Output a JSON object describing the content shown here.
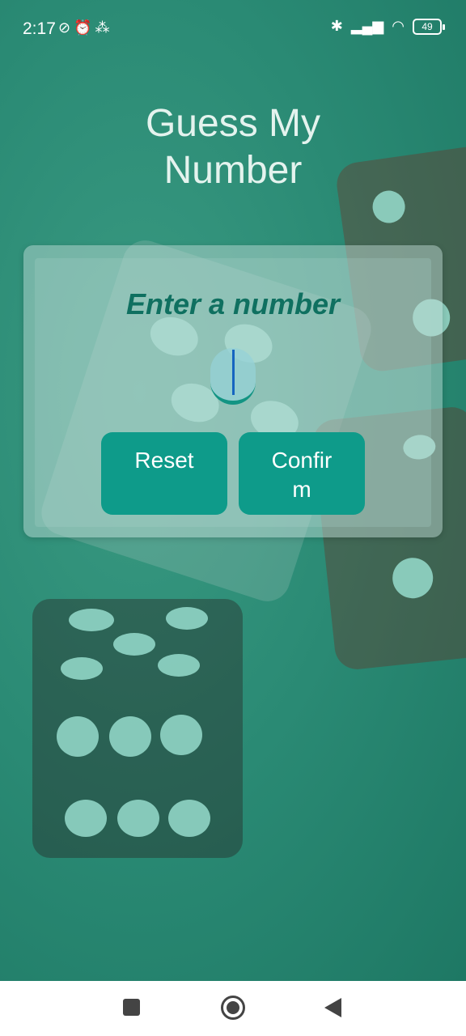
{
  "status_bar": {
    "time": "2:17",
    "left_icons": [
      "vibrate-off-icon",
      "alarm-icon",
      "signal-extra-icon"
    ],
    "right_icons": [
      "bluetooth-icon",
      "cellular-signal-icon",
      "wifi-icon"
    ],
    "battery": "49"
  },
  "app": {
    "title_line1": "Guess My",
    "title_line2": "Number",
    "prompt": "Enter a number",
    "input_value": "",
    "reset_label": "Reset",
    "confirm_label": "Confirm"
  },
  "nav_bar": {
    "icons": [
      "recent-apps-icon",
      "home-icon",
      "back-icon"
    ]
  },
  "colors": {
    "background": "#2a8a74",
    "accent": "#0e9b8a",
    "prompt_text": "#0f7060",
    "title_text": "#e4f3ee"
  }
}
